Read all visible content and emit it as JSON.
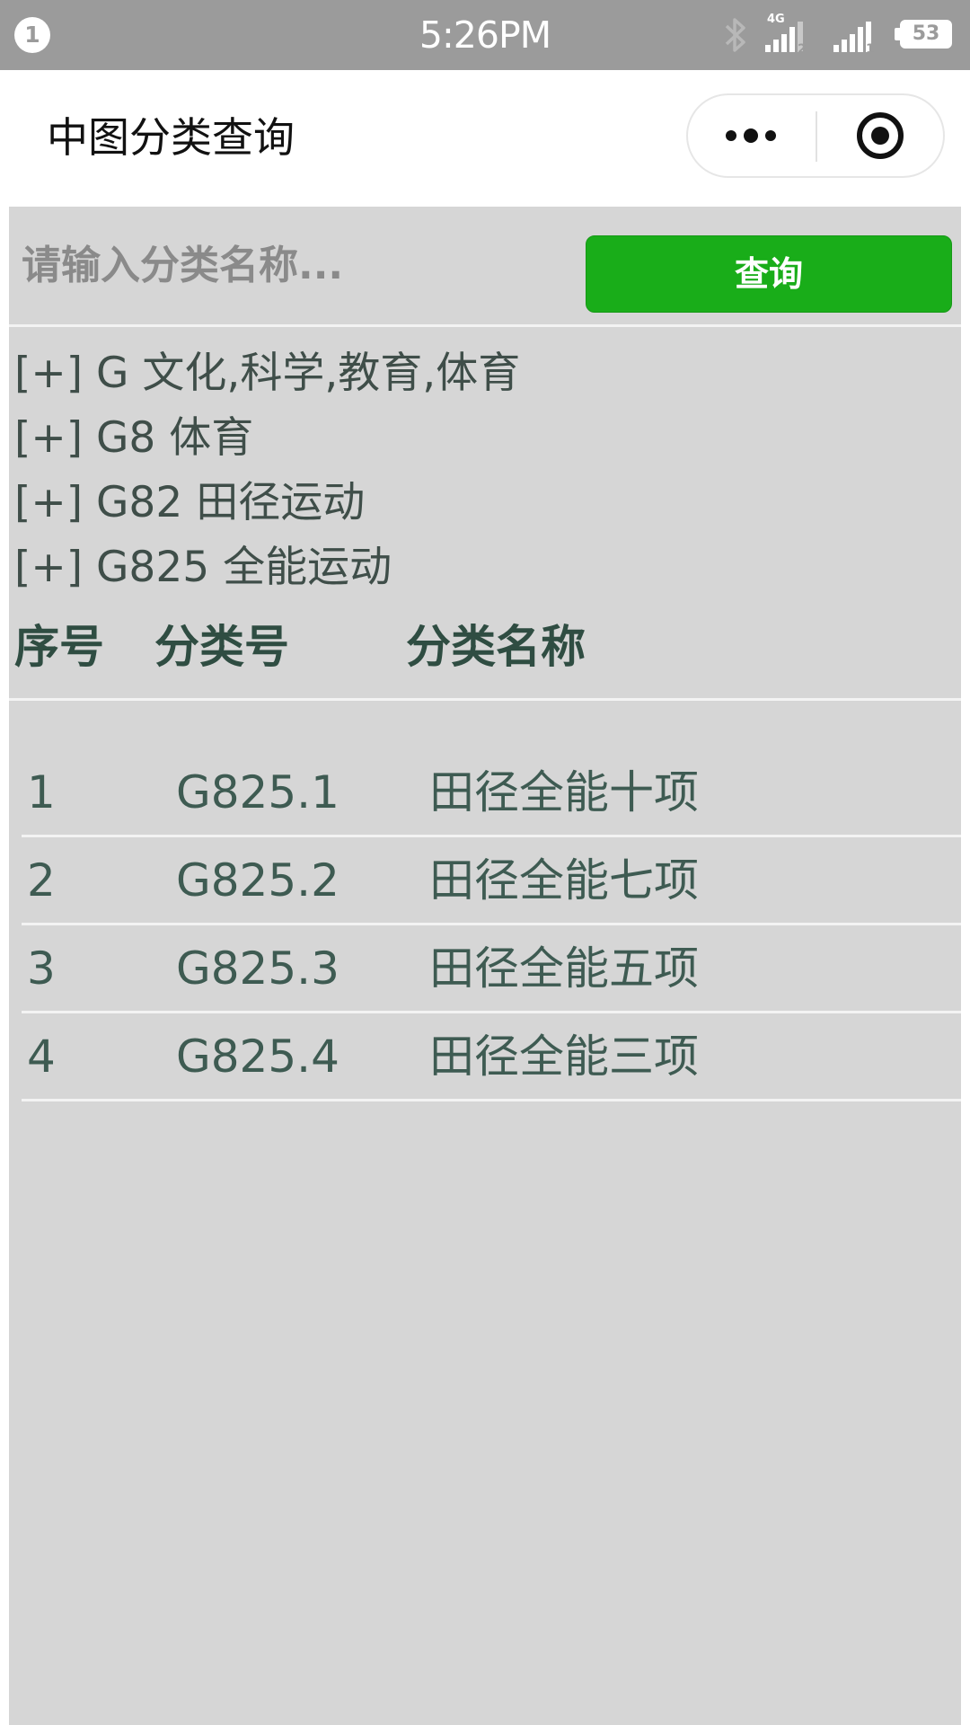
{
  "status_bar": {
    "notification_count": "1",
    "time": "5:26PM",
    "network_type": "4G",
    "sim_slots": [
      "2",
      "1"
    ],
    "battery_level": "53",
    "icons": [
      "notification-badge",
      "bluetooth-icon",
      "signal-icon",
      "battery-icon"
    ]
  },
  "nav_bar": {
    "title": "中图分类查询",
    "icons": [
      "more-icon",
      "close-target-icon"
    ]
  },
  "search": {
    "placeholder": "请输入分类名称...",
    "value": "",
    "button_label": "查询",
    "button_color": "#19ad19"
  },
  "breadcrumb": [
    {
      "prefix": "[+]",
      "code": "G",
      "name": "文化,科学,教育,体育"
    },
    {
      "prefix": "[+]",
      "code": "G8",
      "name": "体育"
    },
    {
      "prefix": "[+]",
      "code": "G82",
      "name": "田径运动"
    },
    {
      "prefix": "[+]",
      "code": "G825",
      "name": "全能运动"
    }
  ],
  "table": {
    "columns": [
      "序号",
      "分类号",
      "分类名称"
    ],
    "rows": [
      {
        "index": "1",
        "code": "G825.1",
        "name": "田径全能十项"
      },
      {
        "index": "2",
        "code": "G825.2",
        "name": "田径全能七项"
      },
      {
        "index": "3",
        "code": "G825.3",
        "name": "田径全能五项"
      },
      {
        "index": "4",
        "code": "G825.4",
        "name": "田径全能三项"
      }
    ]
  },
  "colors": {
    "status_bar": "#9b9b9b",
    "content_background": "#d6d6d6",
    "header_text": "#2f4d42",
    "body_text": "#3e5b52"
  }
}
